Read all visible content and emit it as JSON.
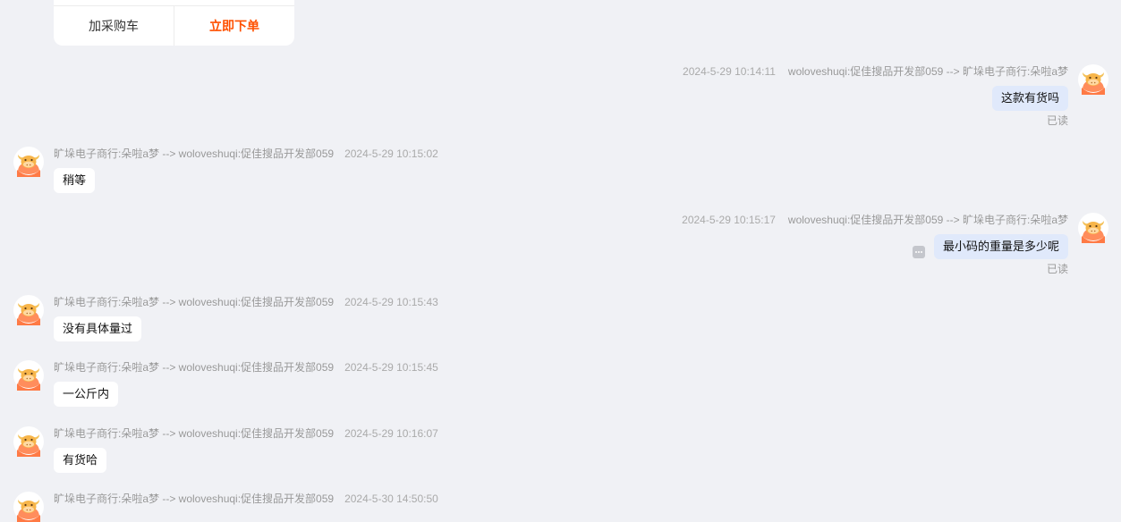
{
  "product_card": {
    "add_to_cart_label": "加采购车",
    "order_now_label": "立即下单",
    "accent_color": "#ff5000"
  },
  "colors": {
    "outgoing_bubble": "#e0e9fb",
    "incoming_bubble": "#ffffff",
    "background": "#f0f1f5"
  },
  "messages": [
    {
      "direction": "out",
      "route": "woloveshuqi:促佳搜品开发部059 --> 旷垛电子商行:朵啦a梦",
      "time": "2024-5-29 10:14:11",
      "text": "这款有货吗",
      "status": "已读"
    },
    {
      "direction": "in",
      "route": "旷垛电子商行:朵啦a梦 --> woloveshuqi:促佳搜品开发部059",
      "time": "2024-5-29 10:15:02",
      "text": "稍等"
    },
    {
      "direction": "out",
      "route": "woloveshuqi:促佳搜品开发部059 --> 旷垛电子商行:朵啦a梦",
      "time": "2024-5-29 10:15:17",
      "text": "最小码的重量是多少呢",
      "status": "已读"
    },
    {
      "direction": "in",
      "route": "旷垛电子商行:朵啦a梦 --> woloveshuqi:促佳搜品开发部059",
      "time": "2024-5-29 10:15:43",
      "text": "没有具体量过"
    },
    {
      "direction": "in",
      "route": "旷垛电子商行:朵啦a梦 --> woloveshuqi:促佳搜品开发部059",
      "time": "2024-5-29 10:15:45",
      "text": "一公斤内"
    },
    {
      "direction": "in",
      "route": "旷垛电子商行:朵啦a梦 --> woloveshuqi:促佳搜品开发部059",
      "time": "2024-5-29 10:16:07",
      "text": "有货哈"
    },
    {
      "direction": "in",
      "route": "旷垛电子商行:朵啦a梦 --> woloveshuqi:促佳搜品开发部059",
      "time": "2024-5-30 14:50:50"
    }
  ],
  "icons": {
    "avatar": "cartoon-cow-avatar-icon",
    "more": "more-options-icon"
  }
}
